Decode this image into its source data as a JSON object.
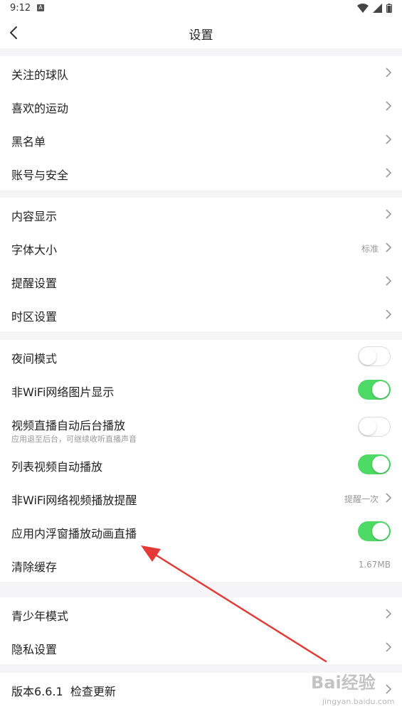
{
  "status_bar": {
    "time": "9:12",
    "notification_glyph": "A"
  },
  "header": {
    "title": "设置"
  },
  "groups": [
    {
      "items": [
        {
          "label": "关注的球队"
        },
        {
          "label": "喜欢的运动"
        },
        {
          "label": "黑名单"
        },
        {
          "label": "账号与安全"
        }
      ]
    },
    {
      "items": [
        {
          "label": "内容显示"
        },
        {
          "label": "字体大小",
          "value": "标准"
        },
        {
          "label": "提醒设置"
        },
        {
          "label": "时区设置"
        }
      ]
    },
    {
      "items": [
        {
          "label": "夜间模式",
          "toggle": false
        },
        {
          "label": "非WiFi网络图片显示",
          "toggle": true
        },
        {
          "label": "视频直播自动后台播放",
          "subtitle": "应用退至后台，可继续收听直播声音",
          "toggle": false
        },
        {
          "label": "列表视频自动播放",
          "toggle": true
        },
        {
          "label": "非WiFi网络视频播放提醒",
          "value": "提醒一次"
        },
        {
          "label": "应用内浮窗播放动画直播",
          "toggle": true
        },
        {
          "label": "清除缓存",
          "value": "1.67MB"
        }
      ]
    },
    {
      "items": [
        {
          "label": "青少年模式"
        },
        {
          "label": "隐私设置"
        }
      ]
    },
    {
      "items": [
        {
          "label": "版本6.6.1  检查更新"
        }
      ]
    }
  ],
  "watermark": {
    "logo": "Bai经验",
    "url": "jingyan.baidu.com"
  },
  "colors": {
    "toggle_on": "#4cd964",
    "annotation_arrow": "#e53935",
    "background": "#f5f5f7"
  }
}
